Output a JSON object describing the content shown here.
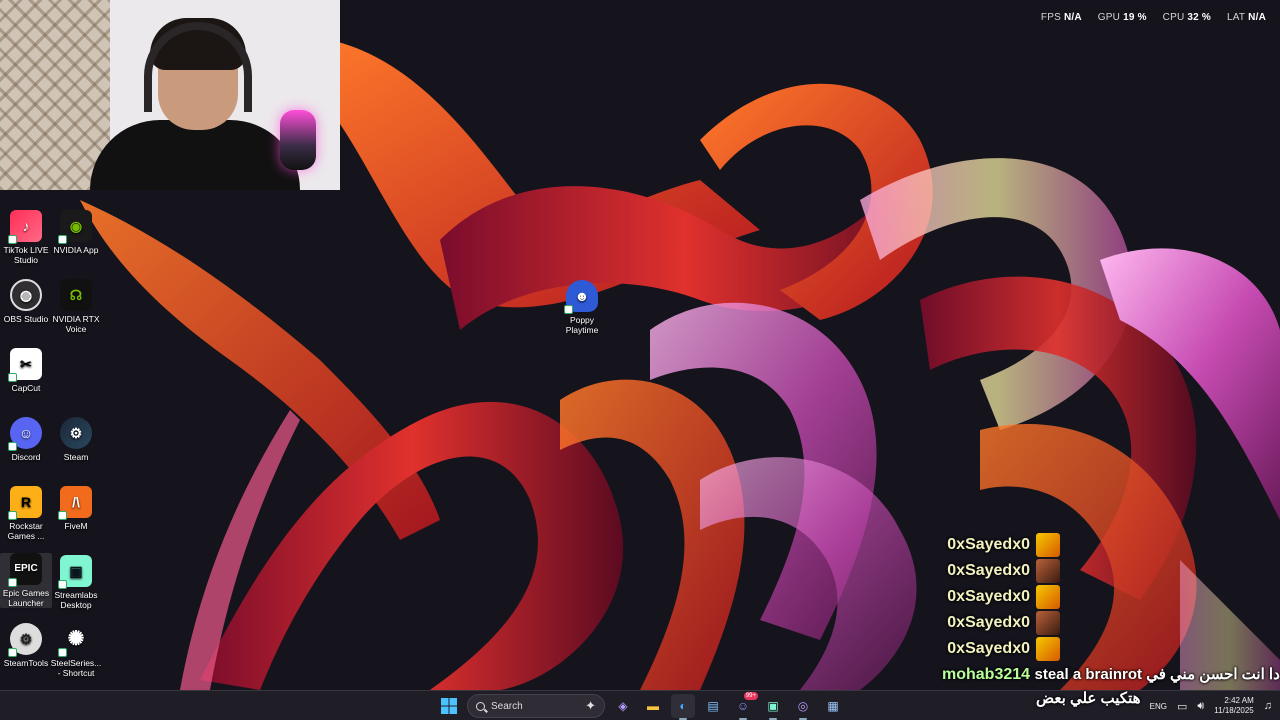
{
  "perf": {
    "fps_label": "FPS",
    "fps_value": "N/A",
    "gpu_label": "GPU",
    "gpu_value": "19 %",
    "cpu_label": "CPU",
    "cpu_value": "32 %",
    "lat_label": "LAT",
    "lat_value": "N/A"
  },
  "desktop_icons": [
    {
      "label": "TikTok LIVE Studio",
      "icon": "tiktok-icon"
    },
    {
      "label": "NVIDIA App",
      "icon": "nvidia-icon"
    },
    {
      "label": "OBS Studio",
      "icon": "obs-icon"
    },
    {
      "label": "NVIDIA RTX Voice",
      "icon": "rtx-voice-icon"
    },
    {
      "label": "CapCut",
      "icon": "capcut-icon"
    },
    {
      "label": "Discord",
      "icon": "discord-icon"
    },
    {
      "label": "Steam",
      "icon": "steam-icon"
    },
    {
      "label": "Rockstar Games ...",
      "icon": "rockstar-icon"
    },
    {
      "label": "FiveM",
      "icon": "fivem-icon"
    },
    {
      "label": "Epic Games Launcher",
      "icon": "epic-games-icon"
    },
    {
      "label": "Streamlabs Desktop",
      "icon": "streamlabs-icon"
    },
    {
      "label": "SteamTools",
      "icon": "steamtools-icon"
    },
    {
      "label": "SteelSeries... - Shortcut",
      "icon": "steelseries-icon"
    },
    {
      "label": "Poppy Playtime",
      "icon": "poppy-playtime-icon"
    }
  ],
  "chat": {
    "repeat_user": "0xSayedx0",
    "message": {
      "user": "mohab3214",
      "text_line1": "steal a brainrot دا انت احسن مني في",
      "text_line2": "هتكيب علي بعض"
    }
  },
  "taskbar": {
    "search_label": "Search",
    "discord_badge": "99+",
    "language": "ENG",
    "time": "2:42 AM",
    "date": "11/18/2025"
  },
  "colors": {
    "accent": "#e8365f",
    "chat_user": "#f2f2c0",
    "chat_message_user": "#b8ff9a",
    "taskbar": "#201e26"
  }
}
